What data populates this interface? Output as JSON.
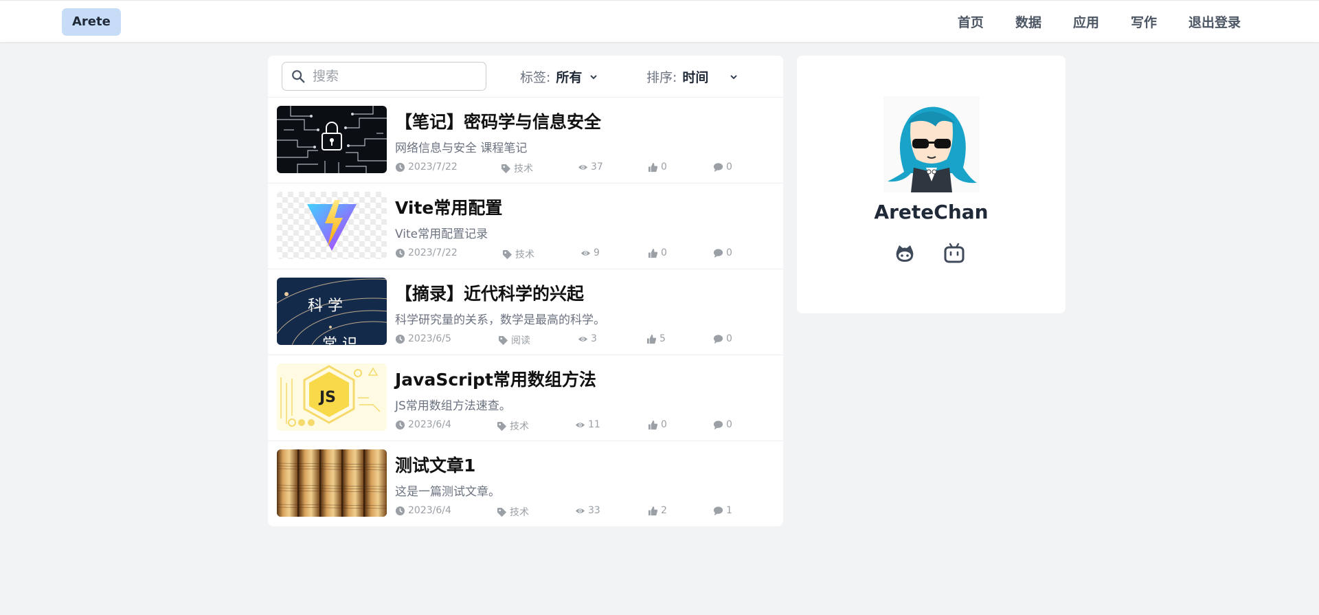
{
  "header": {
    "brand": "Arete",
    "nav": [
      "首页",
      "数据",
      "应用",
      "写作",
      "退出登录"
    ]
  },
  "toolbar": {
    "search_placeholder": "搜索",
    "tag_label": "标签:",
    "tag_value": "所有",
    "sort_label": "排序:",
    "sort_value": "时间"
  },
  "posts": [
    {
      "title": "【笔记】密码学与信息安全",
      "desc": "网络信息与安全 课程笔记",
      "date": "2023/7/22",
      "tag": "技术",
      "views": "37",
      "likes": "0",
      "comments": "0"
    },
    {
      "title": "Vite常用配置",
      "desc": "Vite常用配置记录",
      "date": "2023/7/22",
      "tag": "技术",
      "views": "9",
      "likes": "0",
      "comments": "0"
    },
    {
      "title": "【摘录】近代科学的兴起",
      "desc": "科学研究量的关系，数学是最高的科学。",
      "date": "2023/6/5",
      "tag": "阅读",
      "views": "3",
      "likes": "5",
      "comments": "0"
    },
    {
      "title": "JavaScript常用数组方法",
      "desc": "JS常用数组方法速查。",
      "date": "2023/6/4",
      "tag": "技术",
      "views": "11",
      "likes": "0",
      "comments": "0"
    },
    {
      "title": "测试文章1",
      "desc": "这是一篇测试文章。",
      "date": "2023/6/4",
      "tag": "技术",
      "views": "33",
      "likes": "2",
      "comments": "1"
    }
  ],
  "thumb_text": {
    "science": "科 学",
    "science2": "常 识",
    "js": "JS"
  },
  "profile": {
    "name": "AreteChan",
    "links": [
      "github-icon",
      "bilibili-icon"
    ]
  },
  "colors": {
    "brand_bg": "#c6dcf7",
    "page_bg": "#f2f3f5",
    "meta": "#9aa0a6"
  }
}
